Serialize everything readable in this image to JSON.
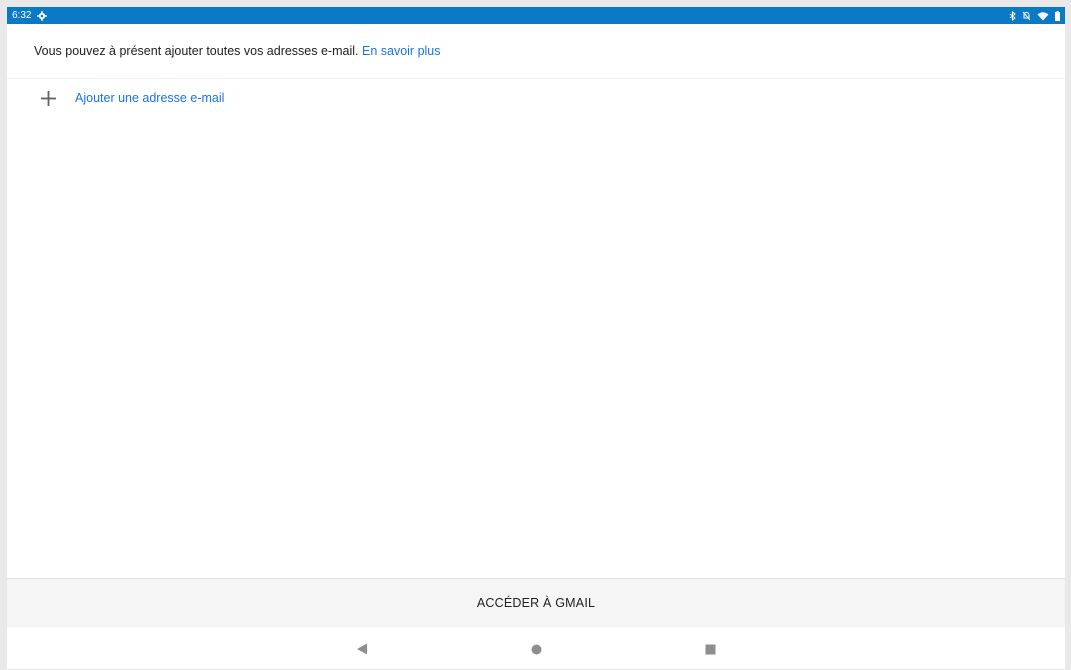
{
  "status_bar": {
    "time": "6:32",
    "color": "#0a7ac6",
    "left_icons": [
      "settings-gear-icon"
    ],
    "right_icons": [
      "bluetooth-icon",
      "silent-mode-icon",
      "wifi-icon",
      "battery-icon"
    ]
  },
  "info": {
    "text": "Vous pouvez à présent ajouter toutes vos adresses e-mail.",
    "link": "En savoir plus"
  },
  "add_email": {
    "icon": "plus-icon",
    "label": "Ajouter une adresse e-mail"
  },
  "footer": {
    "button_label": "ACCÉDER À GMAIL"
  },
  "nav_bar": {
    "buttons": [
      "back-icon",
      "home-icon",
      "recent-apps-icon"
    ]
  },
  "colors": {
    "accent": "#1a73e8",
    "text": "#202124",
    "status_bar": "#0a7ac6"
  }
}
